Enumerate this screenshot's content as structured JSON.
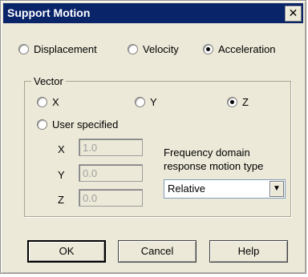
{
  "window": {
    "title": "Support Motion",
    "close_glyph": "✕"
  },
  "motion_types": [
    {
      "label": "Displacement",
      "checked": false
    },
    {
      "label": "Velocity",
      "checked": false
    },
    {
      "label": "Acceleration",
      "checked": true
    }
  ],
  "vector": {
    "group_label": "Vector",
    "options": [
      {
        "label": "X",
        "checked": false
      },
      {
        "label": "Y",
        "checked": false
      },
      {
        "label": "Z",
        "checked": true
      },
      {
        "label": "User specified",
        "checked": false
      }
    ],
    "fields": [
      {
        "label": "X",
        "value": "1.0"
      },
      {
        "label": "Y",
        "value": "0.0"
      },
      {
        "label": "Z",
        "value": "0.0"
      }
    ]
  },
  "frequency": {
    "label_line1": "Frequency domain",
    "label_line2": "response motion type",
    "selected": "Relative",
    "arrow_glyph": "▼"
  },
  "buttons": {
    "ok": "OK",
    "cancel": "Cancel",
    "help": "Help"
  }
}
